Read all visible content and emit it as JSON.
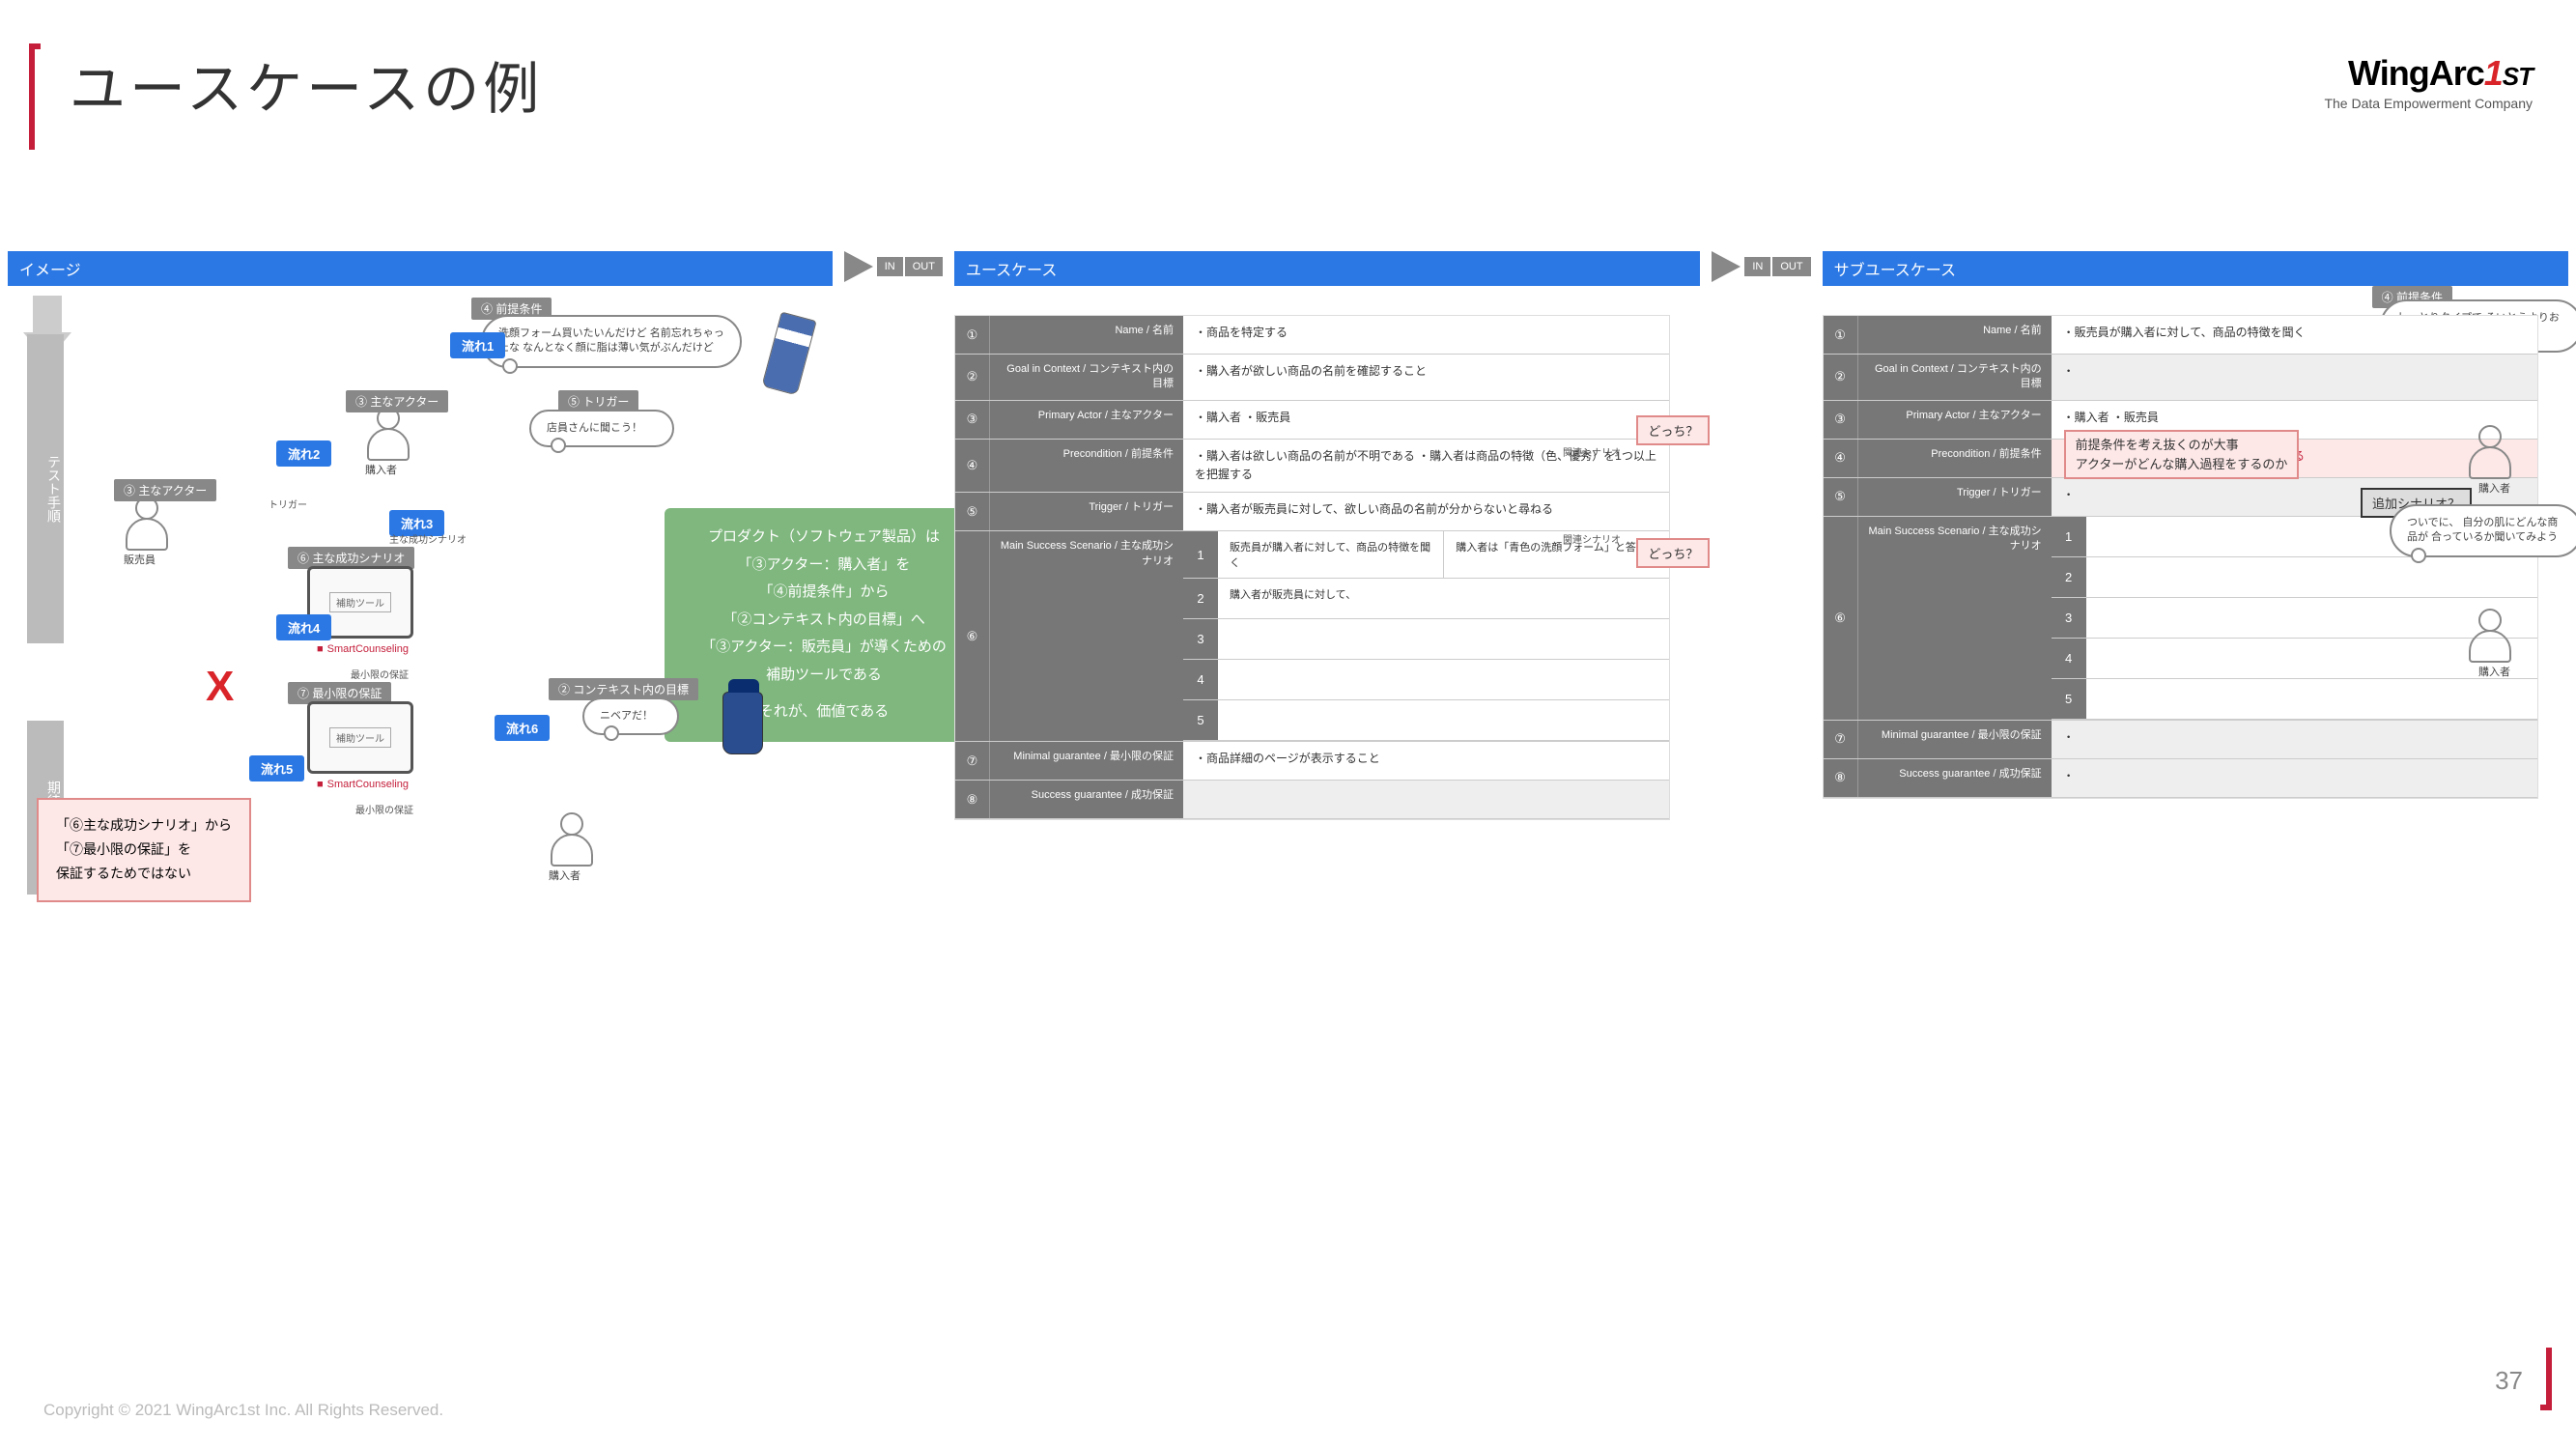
{
  "title": "ユースケースの例",
  "logo": {
    "brand": "WingArc",
    "one": "1",
    "st": "ST",
    "tag": "The Data Empowerment Company"
  },
  "headers": {
    "col1": "イメージ",
    "col2": "ユースケース",
    "col3": "サブユースケース",
    "in": "IN",
    "out": "OUT"
  },
  "sidebars": {
    "test": "テスト手順",
    "result": "期待結果"
  },
  "flows": {
    "f1": "流れ1",
    "f2": "流れ2",
    "f3": "流れ3",
    "f4": "流れ4",
    "f5": "流れ5",
    "f6": "流れ6"
  },
  "tags": {
    "precond": "④ 前提条件",
    "actor_main": "③ 主なアクター",
    "actor_main2": "③ 主なアクター",
    "trigger": "⑤ トリガー",
    "trigger_plain": "トリガー",
    "scenario": "⑥ 主な成功シナリオ",
    "subscenario": "主な成功シナリオ",
    "min_guarantee": "⑦ 最小限の保証",
    "context_goal": "② コンテキスト内の目標",
    "precond_badge": "④ 前提条件"
  },
  "actors": {
    "buyer": "購入者",
    "seller": "販売員"
  },
  "bubbles": {
    "b1": "洗顔フォーム買いたいんだけど\n名前忘れちゃったな\nなんとなく顔に脂は薄い気がぶんだけど",
    "b2": "店員さんに聞こう！",
    "b3": "ニベアだ！",
    "b4": "しっとりタイプで\nそいとうよりおじさん向けの\n商品だったな…",
    "b5": "ついでに、\n自分の肌にどんな商品が\n合っているか聞いてみよう"
  },
  "tablet_label": "補助ツール",
  "smart_counseling": "SmartCounseling",
  "green_box": {
    "l1": "プロダクト（ソフトウェア製品）は",
    "l2": "「③アクター：購入者」を",
    "l3": "「④前提条件」から",
    "l4": "「②コンテキスト内の目標」へ",
    "l5": "「③アクター：販売員」が導くための",
    "l6": "補助ツールである",
    "l7": "それが、価値である"
  },
  "pink_box": {
    "l1": "「⑥主な成功シナリオ」から",
    "l2": "「⑦最小限の保証」を",
    "l3": "保証するためではない"
  },
  "min_text1": "最小限の保証",
  "min_text2": "最小限の保証",
  "red_x": "X",
  "uc": {
    "rows": [
      {
        "n": "①",
        "label": "Name /\n名前",
        "val": "・商品を特定する"
      },
      {
        "n": "②",
        "label": "Goal in Context /\nコンテキスト内の目標",
        "val": "・購入者が欲しい商品の名前を確認すること"
      },
      {
        "n": "③",
        "label": "Primary Actor /\n主なアクター",
        "val": "・購入者\n・販売員"
      },
      {
        "n": "④",
        "label": "Precondition /\n前提条件",
        "val": "・購入者は欲しい商品の名前が不明である\n・購入者は商品の特徴（色、優秀）を1つ以上を把握する"
      },
      {
        "n": "⑤",
        "label": "Trigger /\nトリガー",
        "val": "・購入者が販売員に対して、欲しい商品の名前が分からないと尋ねる"
      },
      {
        "n": "⑥",
        "label": "Main Success Scenario /\n主な成功シナリオ",
        "scenario": [
          {
            "n": "1",
            "t": "販売員が購入者に対して、商品の特徴を聞く",
            "side": "購入者は「青色の洗顔フォーム」と答える"
          },
          {
            "n": "2",
            "t": "購入者が販売員に対して、"
          },
          {
            "n": "3",
            "t": ""
          },
          {
            "n": "4",
            "t": ""
          },
          {
            "n": "5",
            "t": ""
          }
        ]
      },
      {
        "n": "⑦",
        "label": "Minimal guarantee /\n最小限の保証",
        "val": "・商品詳細のページが表示すること"
      },
      {
        "n": "⑧",
        "label": "Success guarantee /\n成功保証",
        "val": ""
      }
    ]
  },
  "sub_uc": {
    "rows": [
      {
        "n": "①",
        "label": "Name /\n名前",
        "val": "・販売員が購入者に対して、商品の特徴を聞く"
      },
      {
        "n": "②",
        "label": "Goal in Context /\nコンテキスト内の目標",
        "val": "・"
      },
      {
        "n": "③",
        "label": "Primary Actor /\n主なアクター",
        "val": "・購入者\n・販売員"
      },
      {
        "n": "④",
        "label": "Precondition /\n前提条件",
        "val": "・購入者の前提条件に対して、パターンがある",
        "hl": true
      },
      {
        "n": "⑤",
        "label": "Trigger /\nトリガー",
        "val": "・"
      },
      {
        "n": "⑥",
        "label": "Main Success Scenario /\n主な成功シナリオ",
        "scenario": [
          {
            "n": "1",
            "t": ""
          },
          {
            "n": "2",
            "t": ""
          },
          {
            "n": "3",
            "t": ""
          },
          {
            "n": "4",
            "t": ""
          },
          {
            "n": "5",
            "t": ""
          }
        ]
      },
      {
        "n": "⑦",
        "label": "Minimal guarantee /\n最小限の保証",
        "val": "・"
      },
      {
        "n": "⑧",
        "label": "Success guarantee /\n成功保証",
        "val": "・"
      }
    ]
  },
  "callouts": {
    "which1": "どっち？",
    "which2": "どっち？",
    "related": "関連シナリオ",
    "related2": "関連シナリオ",
    "addscn": "追加シナリオ？",
    "important1": "前提条件を考え抜くのが大事",
    "important2": "アクターがどんな購入過程をするのか"
  },
  "page": "37",
  "copyright": "Copyright © 2021 WingArc1st Inc.  All Rights Reserved."
}
